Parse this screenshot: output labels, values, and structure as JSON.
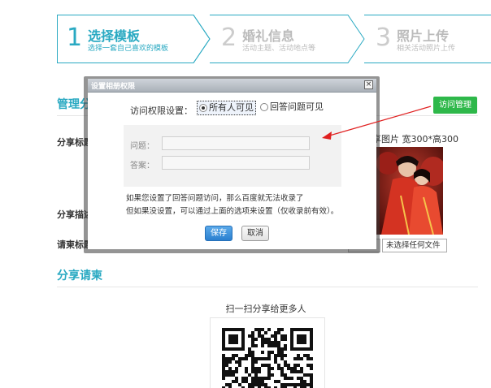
{
  "steps": [
    {
      "num": "1",
      "title": "选择模板",
      "sub": "选择一套自己喜欢的模板"
    },
    {
      "num": "2",
      "title": "婚礼信息",
      "sub": "活动主题、活动地点等"
    },
    {
      "num": "3",
      "title": "照片上传",
      "sub": "相关活动照片上传"
    }
  ],
  "manage_section": {
    "title": "管理分"
  },
  "manage_button": "访问管理",
  "labels": {
    "share_title": "分享标题",
    "share_desc": "分享描述",
    "invite_title": "请柬标题"
  },
  "image_hint": "享图片 宽300*高300",
  "file_input": {
    "filename": "未选择任何文件"
  },
  "share_section": {
    "title": "分享请柬"
  },
  "qr_caption": "扫一扫分享给更多人",
  "modal": {
    "title": "设置相册权限",
    "close": "×",
    "perm_label": "访问权限设置：",
    "options": [
      "所有人可见",
      "回答问题可见"
    ],
    "question_label": "问题：",
    "answer_label": "答案：",
    "note_line1": "如果您设置了回答问题访问，那么百度就无法收录了",
    "note_line2": "但如果没设置，可以通过上面的选项来设置（仅收录前有效）。",
    "save": "保存",
    "cancel": "取消"
  },
  "colors": {
    "accent": "#29a9c2",
    "green": "#2eb84a",
    "arrow": "#e02020"
  }
}
